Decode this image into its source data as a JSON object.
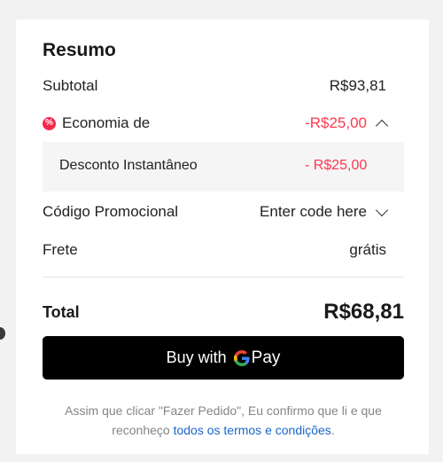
{
  "summary": {
    "title": "Resumo",
    "subtotal_label": "Subtotal",
    "subtotal_value": "R$93,81",
    "savings_label": "Economia de",
    "savings_value": "-R$25,00",
    "savings_icon": "coupon-icon",
    "discount_label": "Desconto Instantâneo",
    "discount_value": "- R$25,00",
    "promo_label": "Código Promocional",
    "promo_placeholder": "Enter code here",
    "shipping_label": "Frete",
    "shipping_value": "grátis",
    "total_label": "Total",
    "total_value": "R$68,81"
  },
  "payment": {
    "button_prefix": "Buy with",
    "button_brand": "Pay"
  },
  "footer": {
    "text": "Assim que clicar \"Fazer Pedido\", Eu confirmo que li e que reconheço",
    "link": "todos os termos e condições",
    "end": "."
  },
  "colors": {
    "accent_red": "#fd384f",
    "link_blue": "#1a66c9",
    "button_black": "#000000"
  }
}
